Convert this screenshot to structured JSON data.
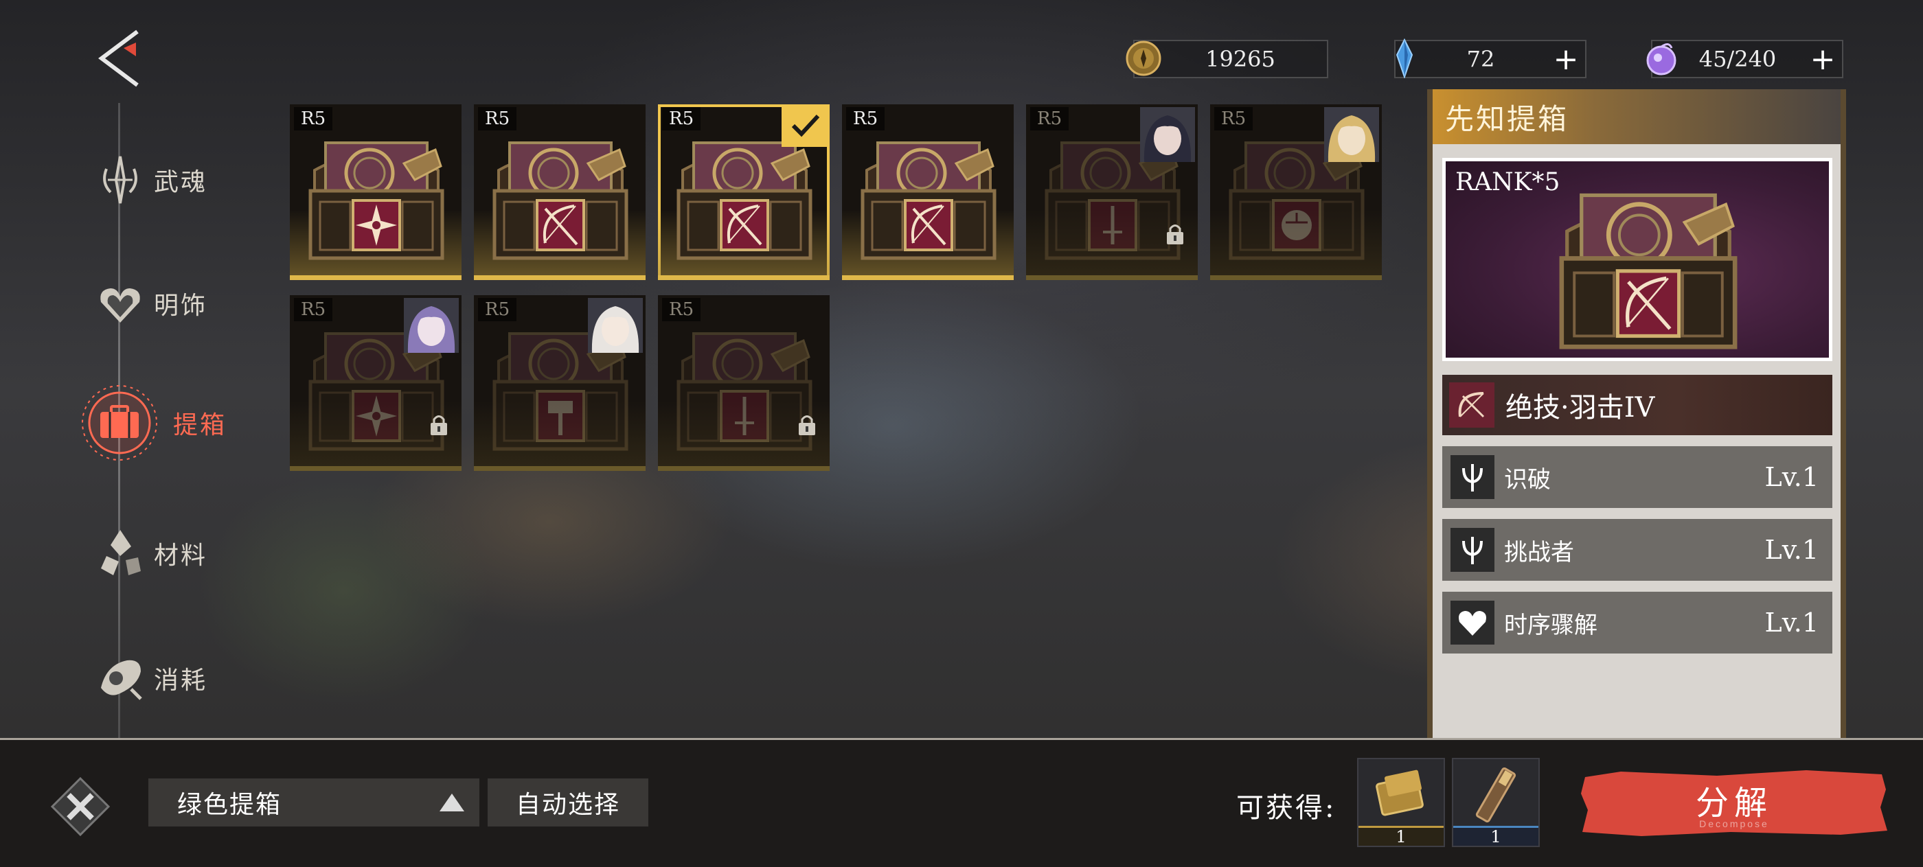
{
  "currency": [
    {
      "icon": "gold-coin-icon",
      "value": "19265",
      "has_plus": false
    },
    {
      "icon": "blue-crystal-icon",
      "value": "72",
      "has_plus": true
    },
    {
      "icon": "purple-orb-icon",
      "value": "45/240",
      "has_plus": true
    }
  ],
  "plus_label": "+",
  "sidebar": {
    "items": [
      {
        "label": "武魂",
        "icon": "warsoul-icon"
      },
      {
        "label": "明饰",
        "icon": "accessory-icon"
      },
      {
        "label": "提箱",
        "icon": "suitcase-icon",
        "active": true
      },
      {
        "label": "材料",
        "icon": "material-icon"
      },
      {
        "label": "消耗",
        "icon": "consumable-icon"
      }
    ]
  },
  "chests": [
    {
      "rank": "R5",
      "emblem": "cross",
      "locked": false,
      "selected": false,
      "portrait": null
    },
    {
      "rank": "R5",
      "emblem": "bow",
      "locked": false,
      "selected": false,
      "portrait": null
    },
    {
      "rank": "R5",
      "emblem": "bow",
      "locked": false,
      "selected": true,
      "portrait": null
    },
    {
      "rank": "R5",
      "emblem": "bow",
      "locked": false,
      "selected": false,
      "portrait": null
    },
    {
      "rank": "R5",
      "emblem": "sword",
      "locked": true,
      "selected": false,
      "portrait": "dark-hair-character"
    },
    {
      "rank": "R5",
      "emblem": "fist",
      "locked": true,
      "selected": false,
      "portrait": "blonde-character"
    },
    {
      "rank": "R5",
      "emblem": "cross",
      "locked": true,
      "selected": false,
      "portrait": "purple-hair-character"
    },
    {
      "rank": "R5",
      "emblem": "hammer",
      "locked": true,
      "selected": false,
      "portrait": "white-hair-character"
    },
    {
      "rank": "R5",
      "emblem": "sword",
      "locked": true,
      "selected": false,
      "portrait": null
    }
  ],
  "detail": {
    "title": "先知提箱",
    "rank_label": "RANK*5",
    "main_skill": "绝技·羽击IV",
    "skills": [
      {
        "name": "识破",
        "level": "Lv.1",
        "icon": "trident-icon"
      },
      {
        "name": "挑战者",
        "level": "Lv.1",
        "icon": "trident-icon"
      },
      {
        "name": "时序骤解",
        "level": "Lv.1",
        "icon": "heart-icon"
      }
    ]
  },
  "bottom": {
    "filter": "绿色提箱",
    "auto_select": "自动选择",
    "obtain_label": "可获得:",
    "rewards": [
      {
        "icon": "gold-material-icon",
        "count": "1"
      },
      {
        "icon": "blue-material-icon",
        "count": "1"
      }
    ],
    "decompose": "分解",
    "decompose_sub": "Decompose"
  },
  "colors": {
    "accent": "#f0c64e",
    "active_nav": "#ff6a52",
    "decompose": "#d9483c"
  }
}
